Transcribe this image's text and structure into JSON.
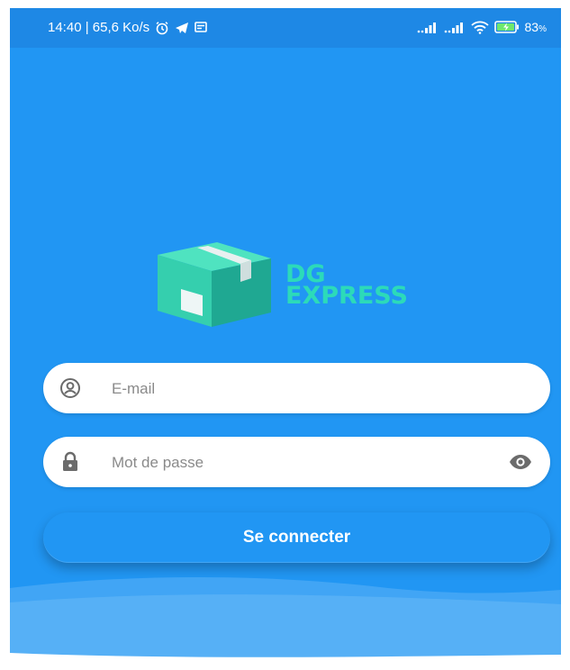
{
  "status_bar": {
    "time_speed": "14:40 | 65,6 Ko/s",
    "battery": "83",
    "battery_unit": "%",
    "icons": [
      "alarm-icon",
      "telegram-icon",
      "message-icon",
      "signal-icon",
      "signal-icon",
      "wifi-icon",
      "battery-charging-icon"
    ]
  },
  "logo": {
    "line1": "DG",
    "line2": "EXPRESS"
  },
  "form": {
    "email_placeholder": "E-mail",
    "password_placeholder": "Mot de passe",
    "email_value": "",
    "password_value": "",
    "submit_label": "Se connecter"
  },
  "colors": {
    "background": "#2196f3",
    "status_bar": "#1e88e5",
    "logo_accent": "#2ee6b0",
    "field": "#ffffff"
  }
}
